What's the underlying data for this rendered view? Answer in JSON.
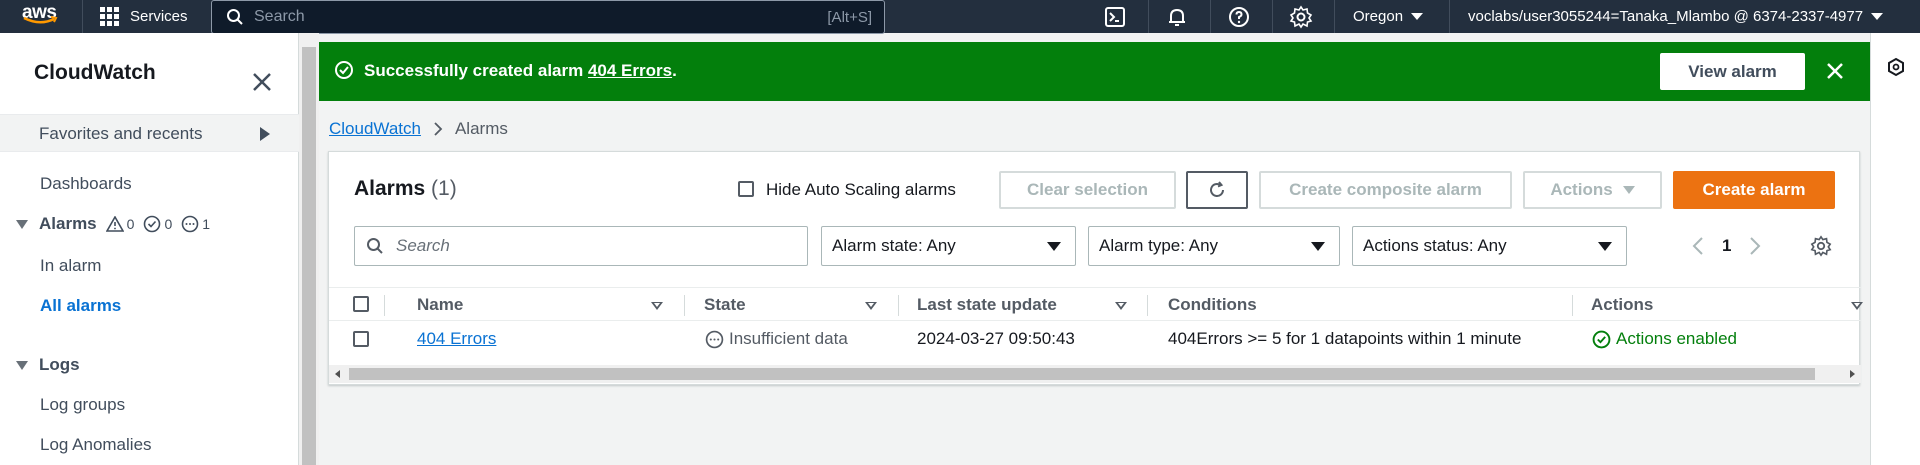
{
  "topnav": {
    "logo_text": "aws",
    "services_label": "Services",
    "search_placeholder": "Search",
    "search_shortcut": "[Alt+S]",
    "icons": [
      "cloudshell-icon",
      "notifications-icon",
      "help-icon",
      "settings-icon"
    ],
    "region": "Oregon",
    "account": "voclabs/user3055244=Tanaka_Mlambo @ 6374-2337-4977"
  },
  "sidebar": {
    "title": "CloudWatch",
    "favorites": "Favorites and recents",
    "dashboards": "Dashboards",
    "alarms_group": "Alarms",
    "alarm_counts": {
      "in_alarm": "0",
      "ok": "0",
      "insufficient": "1"
    },
    "in_alarm": "In alarm",
    "all_alarms": "All alarms",
    "logs_group": "Logs",
    "log_groups": "Log groups",
    "log_anomalies": "Log Anomalies"
  },
  "flash": {
    "prefix": "Successfully created alarm ",
    "alarm_name": "404 Errors",
    "suffix": ".",
    "view_button": "View alarm",
    "color": "#037f0c"
  },
  "breadcrumb": {
    "root": "CloudWatch",
    "current": "Alarms"
  },
  "alarms_panel": {
    "title": "Alarms",
    "count": "(1)",
    "hide_autoscaling_label": "Hide Auto Scaling alarms",
    "clear_selection": "Clear selection",
    "create_composite": "Create composite alarm",
    "actions": "Actions",
    "create_alarm": "Create alarm",
    "search_placeholder": "Search",
    "filters": {
      "alarm_state": "Alarm state: Any",
      "alarm_type": "Alarm type: Any",
      "actions_status": "Actions status: Any"
    },
    "page": "1",
    "columns": [
      "Name",
      "State",
      "Last state update",
      "Conditions",
      "Actions"
    ],
    "rows": [
      {
        "name": "404 Errors",
        "state": "Insufficient data",
        "last_update": "2024-03-27 09:50:43",
        "conditions": "404Errors >= 5 for 1 datapoints within 1 minute",
        "actions": "Actions enabled"
      }
    ],
    "accent_color": "#ec7211"
  }
}
